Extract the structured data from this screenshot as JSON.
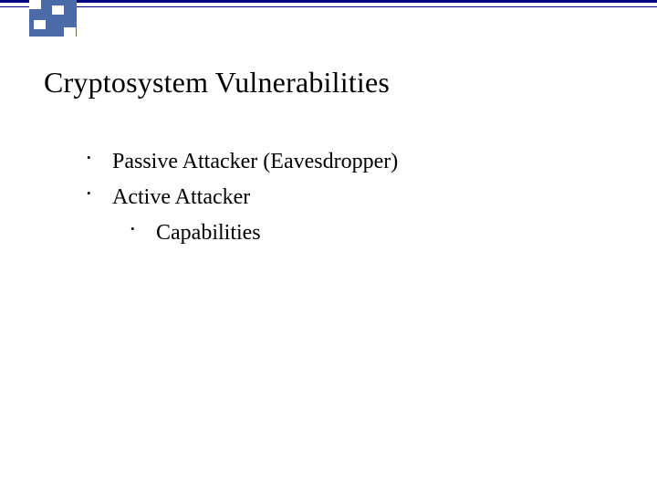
{
  "slide": {
    "title": "Cryptosystem Vulnerabilities",
    "bullets": [
      {
        "text": "Passive Attacker (Eavesdropper)"
      },
      {
        "text": "Active Attacker",
        "children": [
          {
            "text": "Capabilities"
          }
        ]
      }
    ]
  },
  "theme": {
    "accent": "#000080",
    "corner_fill": "#4a6aa8"
  }
}
